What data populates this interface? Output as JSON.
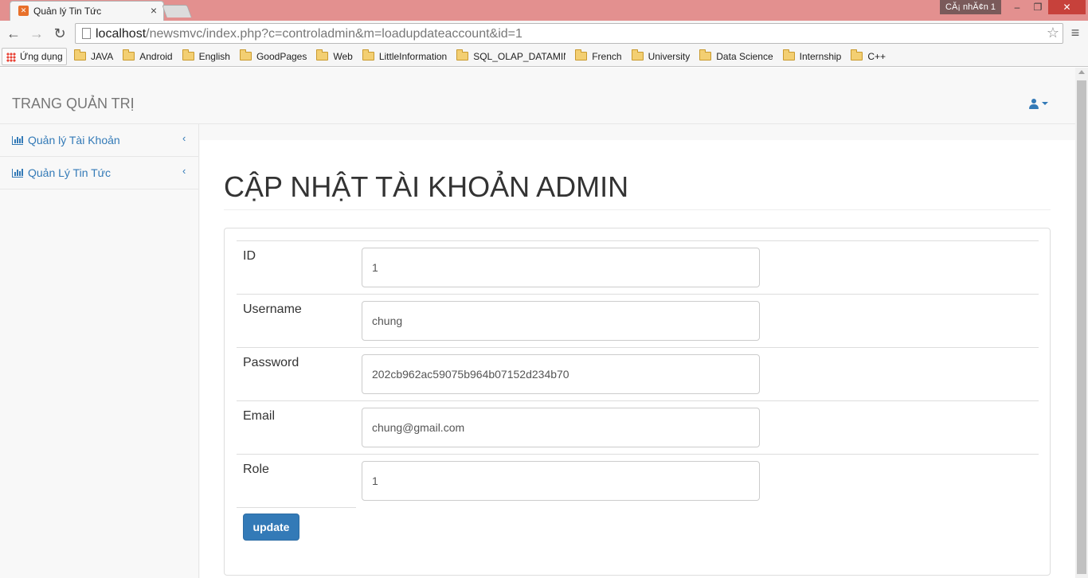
{
  "browser": {
    "tab_title": "Quản lý Tin Tức",
    "tab_close": "×",
    "profile": "CĂ¡ nhĂ¢n 1",
    "window_controls": {
      "minimize": "–",
      "maximize": "❐",
      "close": "✕"
    },
    "nav": {
      "back": "←",
      "forward": "→",
      "reload": "↻",
      "menu": "≡"
    },
    "url_host": "localhost",
    "url_path": "/newsmvc/index.php?c=controladmin&m=loadupdateaccount&id=1",
    "star": "☆"
  },
  "bookmarks": {
    "apps_label": "Ứng dụng",
    "items": [
      "JAVA",
      "Android",
      "English",
      "GoodPages",
      "Web",
      "LittleInformation",
      "SQL_OLAP_DATAMIN",
      "French",
      "University",
      "Data Science",
      "Internship",
      "C++"
    ]
  },
  "navbar": {
    "brand": "TRANG QUẢN TRỊ"
  },
  "sidebar": {
    "items": [
      {
        "label": "Quản lý Tài Khoản",
        "chevron": "‹"
      },
      {
        "label": "Quản Lý Tin Tức",
        "chevron": "‹"
      }
    ]
  },
  "page": {
    "title": "CẬP NHẬT TÀI KHOẢN ADMIN",
    "form": {
      "fields": [
        {
          "label": "ID",
          "value": "1"
        },
        {
          "label": "Username",
          "value": "chung"
        },
        {
          "label": "Password",
          "value": "202cb962ac59075b964b07152d234b70"
        },
        {
          "label": "Email",
          "value": "chung@gmail.com"
        },
        {
          "label": "Role",
          "value": "1"
        }
      ],
      "submit_label": "update"
    }
  },
  "colors": {
    "link": "#337ab7",
    "titlebar": "#e3908f",
    "button": "#337ab7"
  }
}
